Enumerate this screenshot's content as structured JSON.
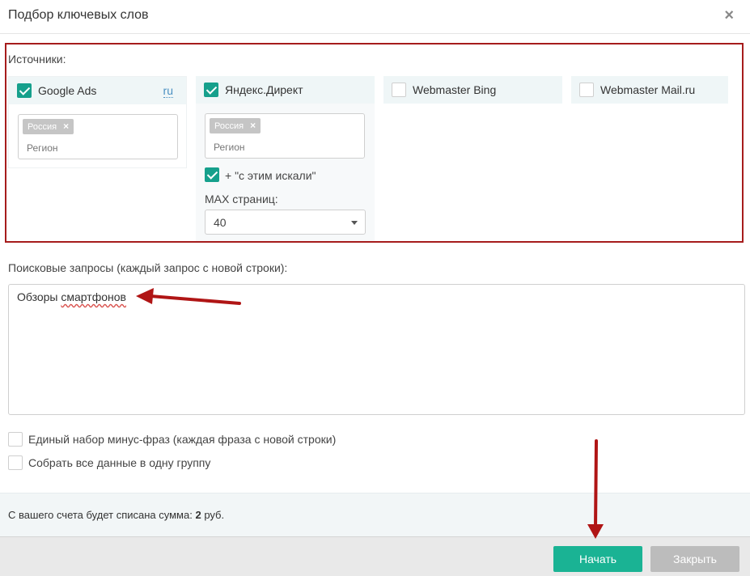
{
  "dialog": {
    "title": "Подбор ключевых слов",
    "close_glyph": "×"
  },
  "sources": {
    "label": "Источники:",
    "google": {
      "label": "Google Ads",
      "checked": true,
      "lang_link": "ru",
      "tag": "Россия",
      "tag_remove": "×",
      "region_placeholder": "Регион"
    },
    "yandex": {
      "label": "Яндекс.Директ",
      "checked": true,
      "tag": "Россия",
      "tag_remove": "×",
      "region_placeholder": "Регион",
      "also_searched_label": "+ \"с этим искали\"",
      "also_searched_checked": true,
      "max_pages_label": "MAX страниц:",
      "max_pages_value": "40"
    },
    "bing": {
      "label": "Webmaster Bing",
      "checked": false
    },
    "mailru": {
      "label": "Webmaster Mail.ru",
      "checked": false
    }
  },
  "queries": {
    "label": "Поисковые запросы (каждый запрос с новой строки):",
    "value_word1": "Обзоры",
    "value_word2": "смартфонов"
  },
  "options": {
    "minus_phrases": {
      "label": "Единый набор минус-фраз (каждая фраза с новой строки)",
      "checked": false
    },
    "one_group": {
      "label": "Собрать все данные в одну группу",
      "checked": false
    }
  },
  "billing": {
    "text_prefix": "С вашего счета будет списана сумма:",
    "amount": "2",
    "currency": "руб."
  },
  "footer": {
    "start_label": "Начать",
    "close_label": "Закрыть"
  },
  "colors": {
    "accent": "#1ab394",
    "checkbox": "#16a08c",
    "highlight_border": "#a61c1c",
    "arrow": "#b01515"
  }
}
